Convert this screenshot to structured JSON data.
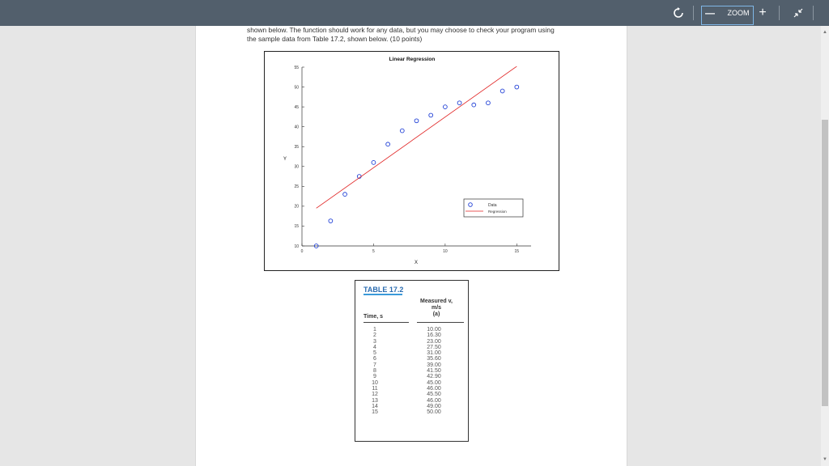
{
  "toolbar": {
    "zoom_label": "ZOOM",
    "zoom_out_symbol": "—",
    "zoom_in_symbol": "+",
    "rotate_icon": "rotate-icon",
    "collapse_icon": "collapse-icon"
  },
  "document": {
    "intro_line1": "shown below. The function should work for any data, but you may choose to check your program using",
    "intro_line2": "the sample data from Table 17.2, shown below. (10 points)"
  },
  "chart_data": {
    "type": "scatter",
    "title": "Linear Regression",
    "xlabel": "X",
    "ylabel": "Y",
    "xlim": [
      0,
      16
    ],
    "ylim": [
      10,
      55
    ],
    "xticks": [
      0,
      5,
      10,
      15
    ],
    "yticks": [
      10,
      15,
      20,
      25,
      30,
      35,
      40,
      45,
      50,
      55
    ],
    "legend_position": "right",
    "series": [
      {
        "name": "Data",
        "kind": "points",
        "color": "#1f3fd6",
        "x": [
          1,
          2,
          3,
          4,
          5,
          6,
          7,
          8,
          9,
          10,
          11,
          12,
          13,
          14,
          15
        ],
        "y": [
          10.0,
          16.3,
          23.0,
          27.5,
          31.0,
          35.6,
          39.0,
          41.5,
          42.9,
          45.0,
          46.0,
          45.5,
          46.0,
          49.0,
          50.0
        ]
      },
      {
        "name": "Regression",
        "kind": "line",
        "color": "#e02020",
        "x": [
          1,
          15
        ],
        "y": [
          19.5,
          55.2
        ]
      }
    ]
  },
  "table": {
    "caption": "TABLE 17.2",
    "col_time_header": "Time, s",
    "col_v_header_line1": "Measured v,",
    "col_v_header_line2": "m/s",
    "col_v_header_line3": "(a)",
    "times": [
      "1",
      "2",
      "3",
      "4",
      "5",
      "6",
      "7",
      "8",
      "9",
      "10",
      "11",
      "12",
      "13",
      "14",
      "15"
    ],
    "velocities": [
      "10.00",
      "16.30",
      "23.00",
      "27.50",
      "31.00",
      "35.60",
      "39.00",
      "41.50",
      "42.90",
      "45.00",
      "46.00",
      "45.50",
      "46.00",
      "49.00",
      "50.00"
    ]
  },
  "colors": {
    "toolbar_bg": "#525f6c",
    "page_bg": "#e6e6e6",
    "accent": "#2b6cb0"
  }
}
